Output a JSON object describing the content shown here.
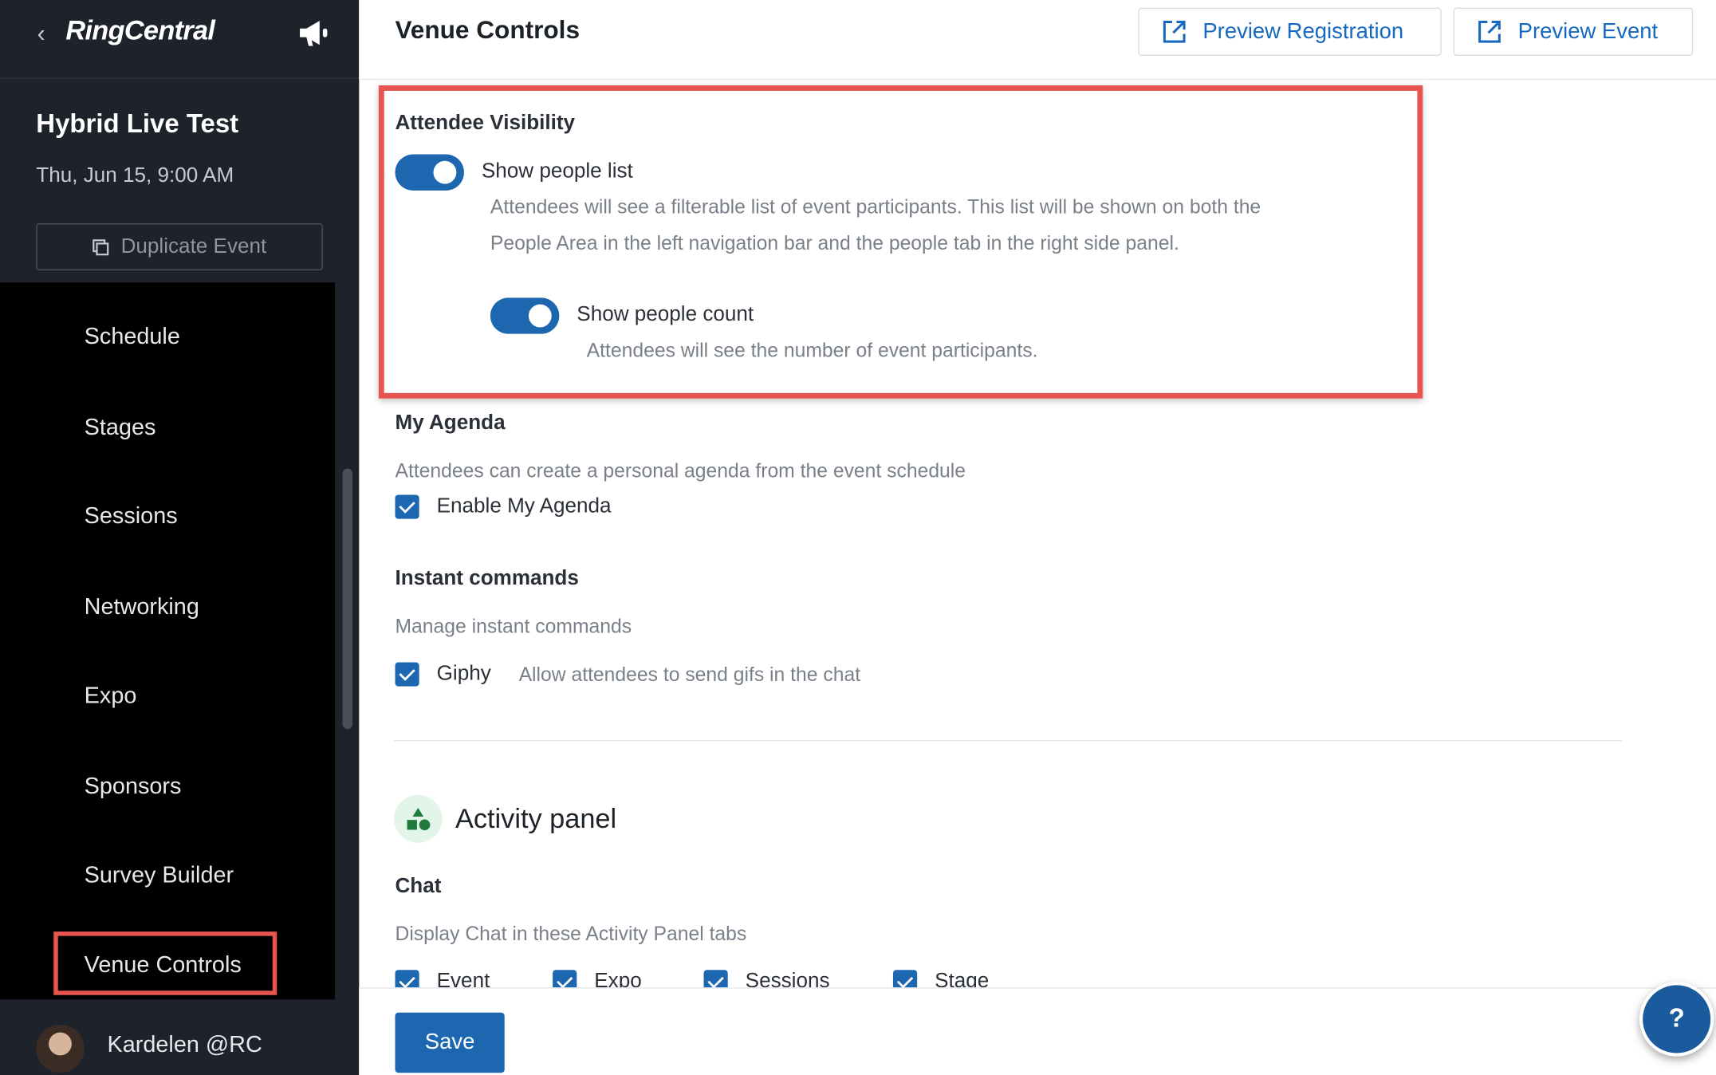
{
  "sidebar": {
    "back_icon": "chevron-left-icon",
    "brand": "RingCentral",
    "megaphone_icon": "megaphone-icon",
    "event_title": "Hybrid Live Test",
    "event_date": "Thu, Jun 15, 9:00 AM",
    "duplicate_label": "Duplicate Event",
    "items": [
      {
        "label": "Schedule"
      },
      {
        "label": "Stages"
      },
      {
        "label": "Sessions"
      },
      {
        "label": "Networking"
      },
      {
        "label": "Expo"
      },
      {
        "label": "Sponsors"
      },
      {
        "label": "Survey Builder"
      },
      {
        "label": "Venue Controls"
      }
    ],
    "active_item": "Venue Controls",
    "user_name": "Kardelen @RC"
  },
  "header": {
    "title": "Venue Controls",
    "preview_registration": "Preview Registration",
    "preview_event": "Preview Event"
  },
  "attendee_visibility": {
    "title": "Attendee Visibility",
    "show_people_list": {
      "label": "Show people list",
      "enabled": true,
      "desc_line1": "Attendees will see a filterable list of event participants. This list will be shown on both the",
      "desc_line2": "People Area in the left navigation bar and the people tab in the right side panel."
    },
    "show_people_count": {
      "label": "Show people count",
      "enabled": true,
      "desc": "Attendees will see the number of event participants."
    }
  },
  "my_agenda": {
    "title": "My Agenda",
    "desc": "Attendees can create a personal agenda from the event schedule",
    "checkbox_label": "Enable My Agenda",
    "checked": true
  },
  "instant_commands": {
    "title": "Instant commands",
    "desc": "Manage instant commands",
    "giphy_label": "Giphy",
    "giphy_desc": "Allow attendees to send gifs in the chat",
    "checked": true
  },
  "activity_panel": {
    "title": "Activity panel",
    "icon": "shapes-icon",
    "chat_title": "Chat",
    "chat_desc": "Display Chat in these Activity Panel tabs",
    "tabs": [
      "Event",
      "Expo",
      "Sessions",
      "Stage"
    ]
  },
  "footer": {
    "save_label": "Save",
    "help_label": "?"
  },
  "colors": {
    "accent": "#1d67b0",
    "highlight": "#e8544f",
    "sidebar_bg": "#000000",
    "sidebar_header_bg": "#1e232b"
  }
}
